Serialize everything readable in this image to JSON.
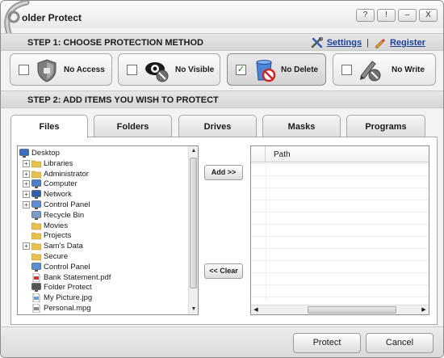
{
  "window": {
    "title": "older Protect",
    "controls": [
      "?",
      "!",
      "–",
      "X"
    ]
  },
  "step1": {
    "label": "STEP 1: CHOOSE PROTECTION METHOD",
    "settings_link": "Settings",
    "separator": "|",
    "register_link": "Register"
  },
  "methods": [
    {
      "label": "No Access",
      "checked": false,
      "icon": "lock-shield-icon"
    },
    {
      "label": "No Visible",
      "checked": false,
      "icon": "eye-mask-icon"
    },
    {
      "label": "No Delete",
      "checked": true,
      "check_mark": "✓",
      "icon": "no-delete-bin-icon"
    },
    {
      "label": "No Write",
      "checked": false,
      "icon": "no-write-pen-icon"
    }
  ],
  "step2": {
    "label": "STEP 2: ADD ITEMS YOU WISH TO PROTECT"
  },
  "tabs": [
    {
      "label": "Files",
      "active": true
    },
    {
      "label": "Folders",
      "active": false
    },
    {
      "label": "Drives",
      "active": false
    },
    {
      "label": "Masks",
      "active": false
    },
    {
      "label": "Programs",
      "active": false
    }
  ],
  "tree": {
    "items": [
      {
        "label": "Desktop",
        "icon": "desktop-icon",
        "expander": ""
      },
      {
        "label": "Libraries",
        "icon": "folder-icon",
        "expander": "+"
      },
      {
        "label": "Administrator",
        "icon": "user-folder-icon",
        "expander": "+"
      },
      {
        "label": "Computer",
        "icon": "computer-icon",
        "expander": "+"
      },
      {
        "label": "Network",
        "icon": "network-icon",
        "expander": "+"
      },
      {
        "label": "Control Panel",
        "icon": "control-panel-icon",
        "expander": "+"
      },
      {
        "label": "Recycle Bin",
        "icon": "recycle-bin-icon",
        "expander": ""
      },
      {
        "label": "Movies",
        "icon": "folder-icon",
        "expander": ""
      },
      {
        "label": "Projects",
        "icon": "folder-icon",
        "expander": ""
      },
      {
        "label": "Sam's Data",
        "icon": "folder-icon",
        "expander": "+"
      },
      {
        "label": "Secure",
        "icon": "folder-icon",
        "expander": ""
      },
      {
        "label": "Control Panel",
        "icon": "control-panel-icon",
        "expander": ""
      },
      {
        "label": "Bank Statement.pdf",
        "icon": "pdf-file-icon",
        "expander": ""
      },
      {
        "label": "Folder Protect",
        "icon": "app-icon",
        "expander": ""
      },
      {
        "label": "My Picture.jpg",
        "icon": "image-file-icon",
        "expander": ""
      },
      {
        "label": "Personal.mpg",
        "icon": "video-file-icon",
        "expander": ""
      }
    ]
  },
  "buttons": {
    "add": "Add >>",
    "clear": "<< Clear",
    "protect": "Protect",
    "cancel": "Cancel"
  },
  "pathlist": {
    "column": "Path"
  },
  "colors": {
    "link": "#1a3f9c",
    "check": "#1b7a1b"
  }
}
